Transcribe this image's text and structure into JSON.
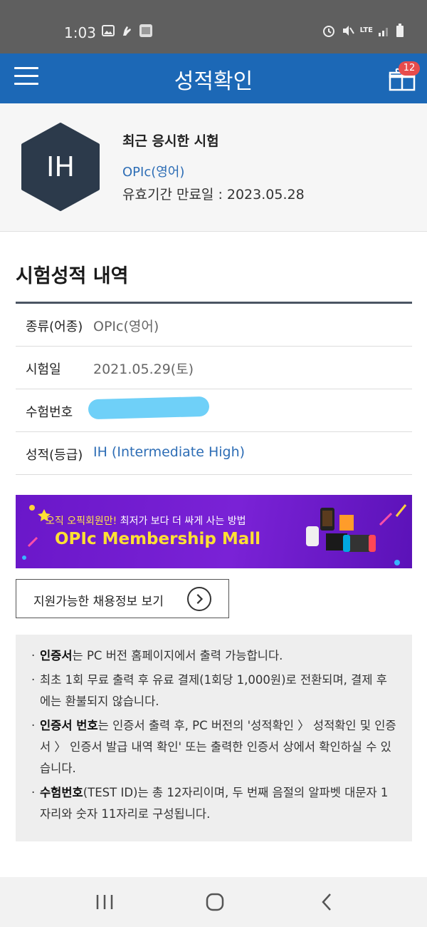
{
  "status_bar": {
    "time": "1:03",
    "network": "LTE"
  },
  "app_bar": {
    "title": "성적확인",
    "gift_badge": "12"
  },
  "recent_exam": {
    "grade": "IH",
    "heading": "최근 응시한 시험",
    "exam_name": "OPIc(영어)",
    "expiry": "유효기간 만료일 : 2023.05.28"
  },
  "score_section": {
    "title": "시험성적 내역",
    "rows": [
      {
        "label": "종류(어종)",
        "value": "OPIc(영어)"
      },
      {
        "label": "시험일",
        "value": "2021.05.29(토)"
      },
      {
        "label": "수험번호",
        "value": ""
      },
      {
        "label": "성적(등급)",
        "value": "IH (Intermediate High)"
      }
    ]
  },
  "banner": {
    "sub_highlight": "오직 오픽회원만!",
    "sub_rest": " 최저가 보다 더 싸게 사는 방법",
    "main": "OPIc Membership Mall"
  },
  "jobs_button": {
    "label": "지원가능한 채용정보 보기"
  },
  "notices": [
    {
      "bold": "인증서",
      "text": "는 PC 버전 홈페이지에서 출력 가능합니다."
    },
    {
      "bold": "",
      "text": "최초 1회 무료 출력 후 유료 결제(1회당 1,000원)로 전환되며, 결제 후에는 환불되지 않습니다."
    },
    {
      "bold": "인증서 번호",
      "text": "는 인증서 출력 후, PC 버전의 '성적확인 〉 성적확인 및 인증서 〉 인증서 발급 내역 확인' 또는 출력한 인증서 상에서 확인하실 수 있습니다."
    },
    {
      "bold": "수험번호",
      "text": "(TEST ID)는 총 12자리이며, 두 번째 음절의 알파벳 대문자 1자리와 숫자 11자리로 구성됩니다."
    }
  ],
  "colors": {
    "brand_blue": "#1c68b6",
    "hex_dark": "#2c3a4b",
    "banner_purple": "#7a22d6",
    "banner_yellow": "#ffe033"
  }
}
